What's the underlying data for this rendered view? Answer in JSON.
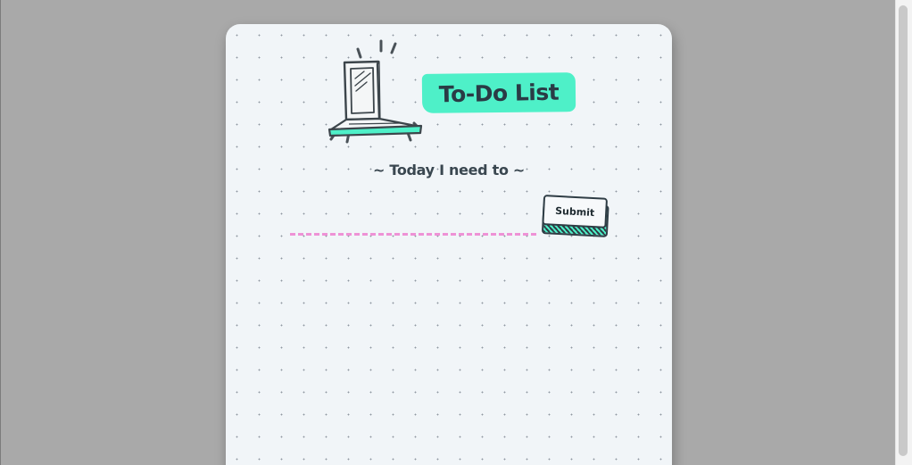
{
  "page": {
    "title": "To-Do List",
    "subtitle": "~ Today I need to ~"
  },
  "form": {
    "input_value": "",
    "submit_label": "Submit"
  },
  "icons": {
    "header_illustration": "laptop-icon"
  },
  "colors": {
    "accent": "#4ef0c8",
    "input_underline": "#ee92d6",
    "ink": "#2a3b45",
    "card_background": "#f1f5f8",
    "page_background": "#a9a9a9"
  }
}
